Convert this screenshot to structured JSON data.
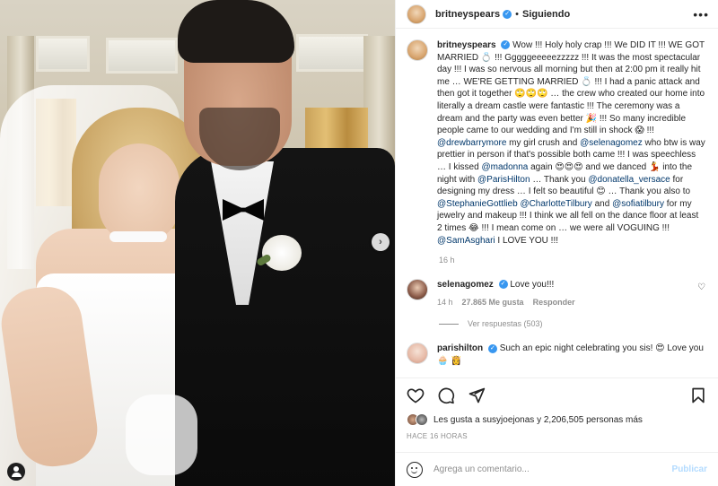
{
  "post": {
    "username": "britneyspears",
    "follow_status": "Siguiendo",
    "more": "•••",
    "separator": "•"
  },
  "caption": {
    "username": "britneyspears",
    "parts": [
      "Wow !!! Holy holy crap !!! We DID IT !!! WE GOT MARRIED 💍 !!! Gggggeeeeezzzzz !!! It was the most spectacular day !!! I was so nervous all morning but then at 2:00 pm it really hit me … WE'RE GETTING MARRIED 💍 !!! I had a panic attack and then got it together 🙄🙄🙄 … the crew who created our home into literally a dream castle were fantastic !!! The ceremony was a dream and the party was even better 🎉 !!! So many incredible people came to our wedding and I'm still in shock 😱 !!! ",
      "@drewbarrymore",
      " my girl crush and ",
      "@selenagomez",
      " who btw is way prettier in person if that's possible both came !!! I was speechless … I kissed ",
      "@madonna",
      " again 😍😍😍 and we danced 💃 into the night with ",
      "@ParisHilton",
      " … Thank you ",
      "@donatella_versace",
      " for designing my dress … I felt so beautiful 😊 … Thank you also to ",
      "@StephanieGottlieb",
      " ",
      "@CharlotteTilbury",
      " and ",
      "@sofiatilbury",
      " for my jewelry and makeup !!! I think we all fell on the dance floor at least 2 times 😂 !!! I mean come on … we were all VOGUING !!! ",
      "@SamAsghari",
      " I LOVE YOU !!!"
    ],
    "time": "16 h"
  },
  "comments": [
    {
      "username": "selenagomez",
      "text": "Love you!!!",
      "time": "14 h",
      "likes": "27.865 Me gusta",
      "reply": "Responder",
      "view_replies": "Ver respuestas (503)"
    },
    {
      "username": "parishilton",
      "text": "Such an epic night celebrating you sis! 😍 Love you🧁 👸"
    }
  ],
  "likes_text": "Les gusta a susyjoejonas y 2,206,505 personas más",
  "post_time": "HACE 16 HORAS",
  "add_comment": {
    "placeholder": "Agrega un comentario...",
    "publish": "Publicar"
  },
  "icons": {
    "nav_next": "›",
    "heart": "♡"
  }
}
